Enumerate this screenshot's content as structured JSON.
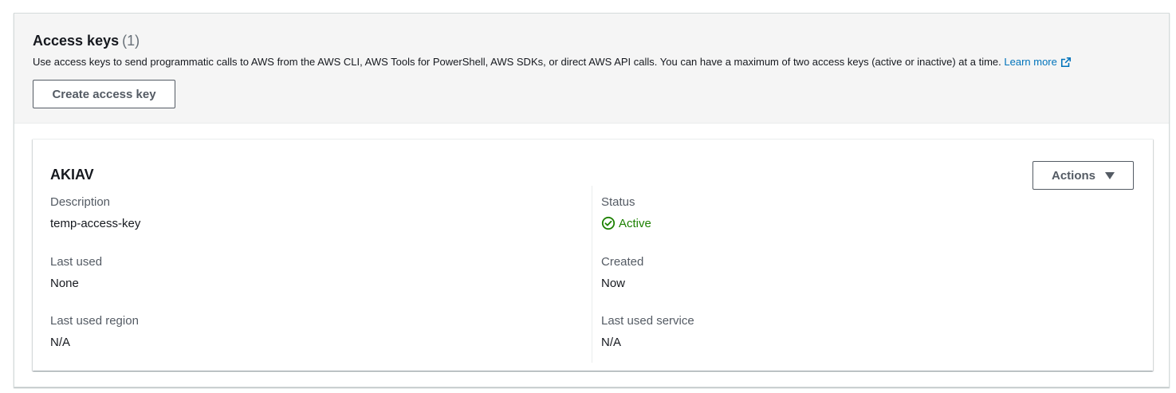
{
  "header": {
    "title": "Access keys",
    "count": "(1)",
    "description": "Use access keys to send programmatic calls to AWS from the AWS CLI, AWS Tools for PowerShell, AWS SDKs, or direct AWS API calls. You can have a maximum of two access keys (active or inactive) at a time.",
    "learn_more": "Learn more",
    "create_button": "Create access key"
  },
  "key": {
    "id": "AKIAV",
    "actions_button": "Actions",
    "fields": {
      "description_label": "Description",
      "description_value": "temp-access-key",
      "status_label": "Status",
      "status_value": "Active",
      "last_used_label": "Last used",
      "last_used_value": "None",
      "created_label": "Created",
      "created_value": "Now",
      "last_used_region_label": "Last used region",
      "last_used_region_value": "N/A",
      "last_used_service_label": "Last used service",
      "last_used_service_value": "N/A"
    }
  },
  "colors": {
    "link": "#0073bb",
    "status_active": "#1d8102",
    "header_bg": "#f5f5f5",
    "button_border": "#545b64"
  },
  "icons": {
    "external_link": "external-link-icon",
    "status_check": "check-circle-icon",
    "dropdown": "caret-down-icon"
  }
}
